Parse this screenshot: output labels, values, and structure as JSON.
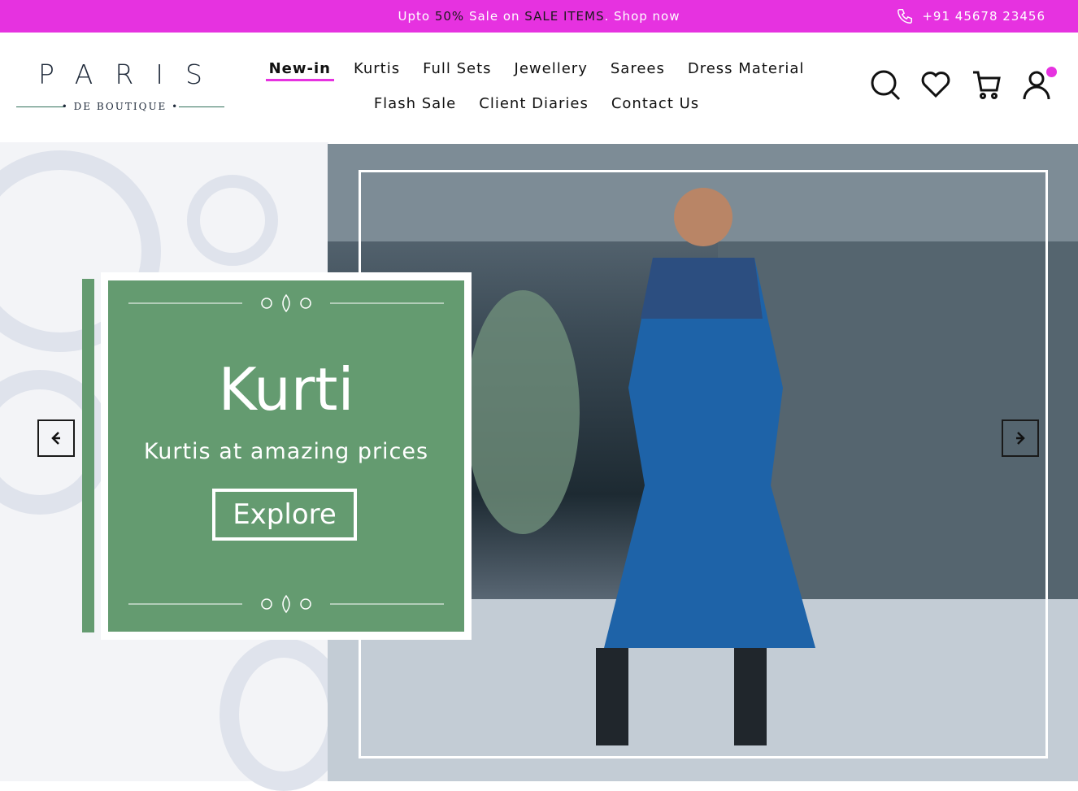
{
  "topbar": {
    "promo_pre": "Upto ",
    "promo_pct": "50%",
    "promo_mid": " Sale on ",
    "promo_items": "SALE ITEMS",
    "promo_post": ". Shop now",
    "phone": "+91 45678 23456"
  },
  "logo": {
    "word": "PARIS",
    "sub": "DE BOUTIQUE"
  },
  "nav": {
    "row1": [
      "New-in",
      "Kurtis",
      "Full Sets",
      "Jewellery",
      "Sarees",
      "Dress Material"
    ],
    "row2": [
      "Flash Sale",
      "Client Diaries",
      "Contact Us"
    ]
  },
  "hero": {
    "title": "Kurti",
    "subtitle": "Kurtis at amazing prices",
    "button": "Explore"
  },
  "colors": {
    "accent": "#e632e0",
    "card": "#649b70"
  },
  "icons": [
    "phone-icon",
    "search-icon",
    "heart-icon",
    "cart-icon",
    "user-icon",
    "arrow-left-icon",
    "arrow-right-icon"
  ]
}
